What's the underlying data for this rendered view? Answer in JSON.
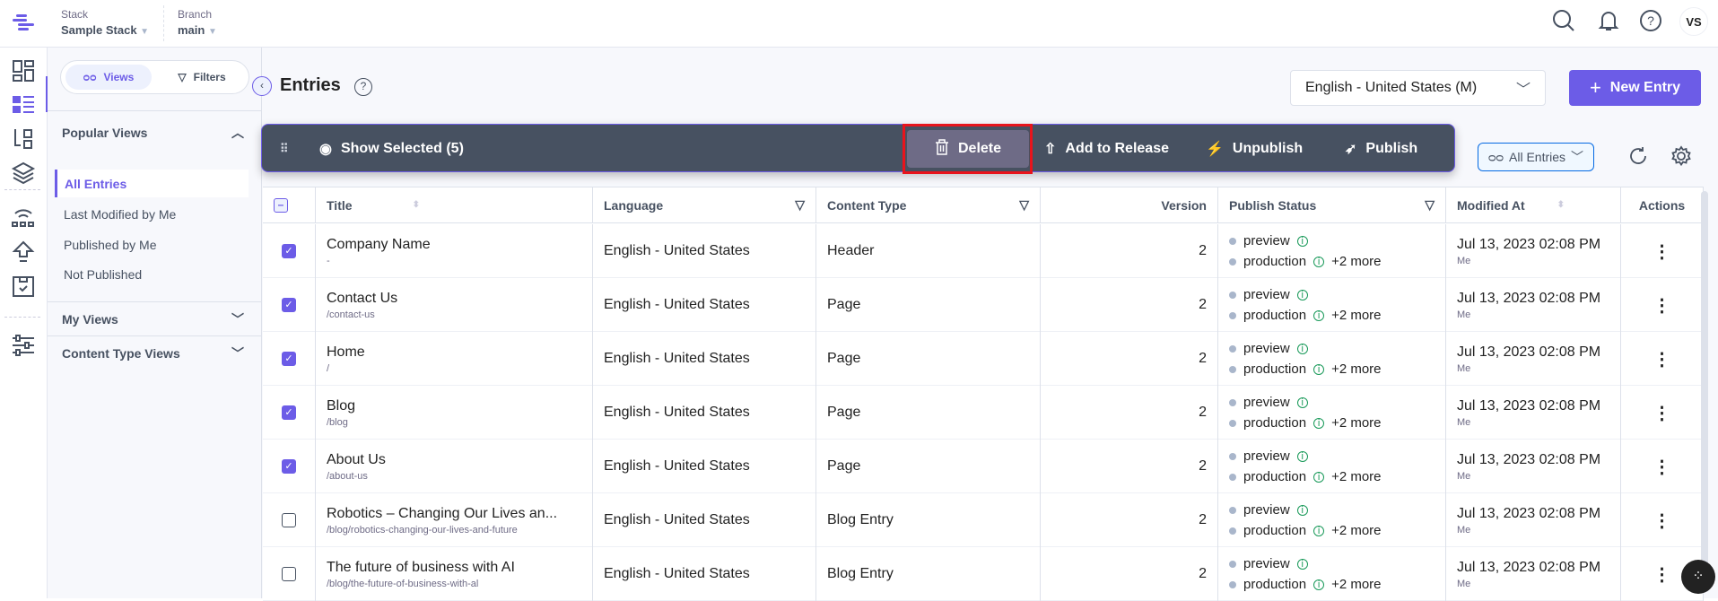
{
  "header": {
    "stack_label": "Stack",
    "stack_value": "Sample Stack",
    "branch_label": "Branch",
    "branch_value": "main",
    "avatar": "VS"
  },
  "sidebar": {
    "views_tab": "Views",
    "filters_tab": "Filters",
    "popular_views": "Popular Views",
    "items": [
      {
        "label": "All Entries",
        "active": true
      },
      {
        "label": "Last Modified by Me"
      },
      {
        "label": "Published by Me"
      },
      {
        "label": "Not Published"
      }
    ],
    "my_views": "My Views",
    "content_type_views": "Content Type Views"
  },
  "main": {
    "title": "Entries",
    "locale": "English - United States (M)",
    "new_entry": "New Entry",
    "view_select": "All Entries"
  },
  "bulk_bar": {
    "show_selected": "Show Selected (5)",
    "delete": "Delete",
    "add_to_release": "Add to Release",
    "unpublish": "Unpublish",
    "publish": "Publish"
  },
  "table": {
    "columns": [
      "Title",
      "Language",
      "Content Type",
      "Version",
      "Publish Status",
      "Modified At",
      "Actions"
    ],
    "rows": [
      {
        "title": "Company Name",
        "url": "-",
        "language": "English - United States",
        "type": "Header",
        "version": "2",
        "env1": "preview",
        "env2": "production",
        "more": "+2 more",
        "modified": "Jul 13, 2023 02:08 PM",
        "by": "Me",
        "checked": true
      },
      {
        "title": "Contact Us",
        "url": "/contact-us",
        "language": "English - United States",
        "type": "Page",
        "version": "2",
        "env1": "preview",
        "env2": "production",
        "more": "+2 more",
        "modified": "Jul 13, 2023 02:08 PM",
        "by": "Me",
        "checked": true
      },
      {
        "title": "Home",
        "url": "/",
        "language": "English - United States",
        "type": "Page",
        "version": "2",
        "env1": "preview",
        "env2": "production",
        "more": "+2 more",
        "modified": "Jul 13, 2023 02:08 PM",
        "by": "Me",
        "checked": true
      },
      {
        "title": "Blog",
        "url": "/blog",
        "language": "English - United States",
        "type": "Page",
        "version": "2",
        "env1": "preview",
        "env2": "production",
        "more": "+2 more",
        "modified": "Jul 13, 2023 02:08 PM",
        "by": "Me",
        "checked": true
      },
      {
        "title": "About Us",
        "url": "/about-us",
        "language": "English - United States",
        "type": "Page",
        "version": "2",
        "env1": "preview",
        "env2": "production",
        "more": "+2 more",
        "modified": "Jul 13, 2023 02:08 PM",
        "by": "Me",
        "checked": true
      },
      {
        "title": "Robotics – Changing Our Lives an...",
        "url": "/blog/robotics-changing-our-lives-and-future",
        "language": "English - United States",
        "type": "Blog Entry",
        "version": "2",
        "env1": "preview",
        "env2": "production",
        "more": "+2 more",
        "modified": "Jul 13, 2023 02:08 PM",
        "by": "Me",
        "checked": false
      },
      {
        "title": "The future of business with AI",
        "url": "/blog/the-future-of-business-with-al",
        "language": "English - United States",
        "type": "Blog Entry",
        "version": "2",
        "env1": "preview",
        "env2": "production",
        "more": "+2 more",
        "modified": "Jul 13, 2023 02:08 PM",
        "by": "Me",
        "checked": false
      }
    ]
  },
  "colors": {
    "accent": "#6c5ce7",
    "bulk_bar": "#475161",
    "highlight": "#e8141c"
  }
}
